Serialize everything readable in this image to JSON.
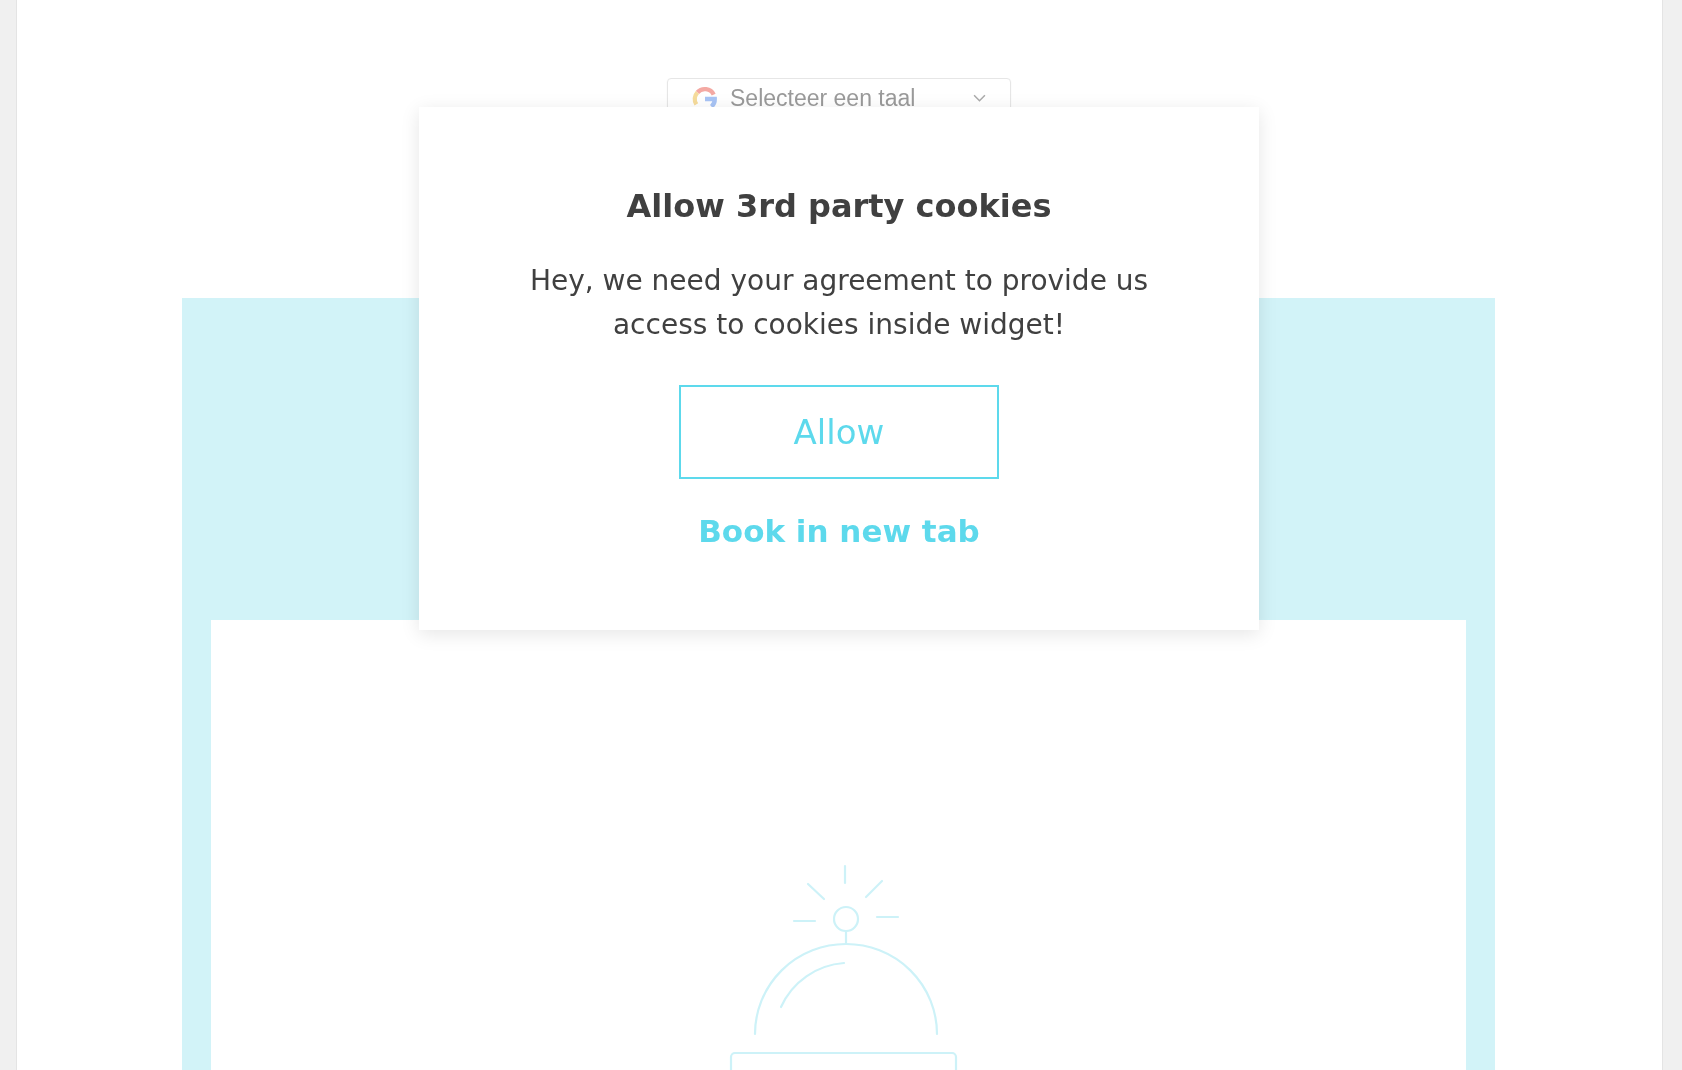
{
  "language_selector": {
    "label": "Selecteer een taal"
  },
  "cookie_dialog": {
    "title": "Allow 3rd party cookies",
    "message": "Hey, we need your agreement to provide us access to cookies inside widget!",
    "allow_button": "Allow",
    "link": "Book in new tab"
  }
}
